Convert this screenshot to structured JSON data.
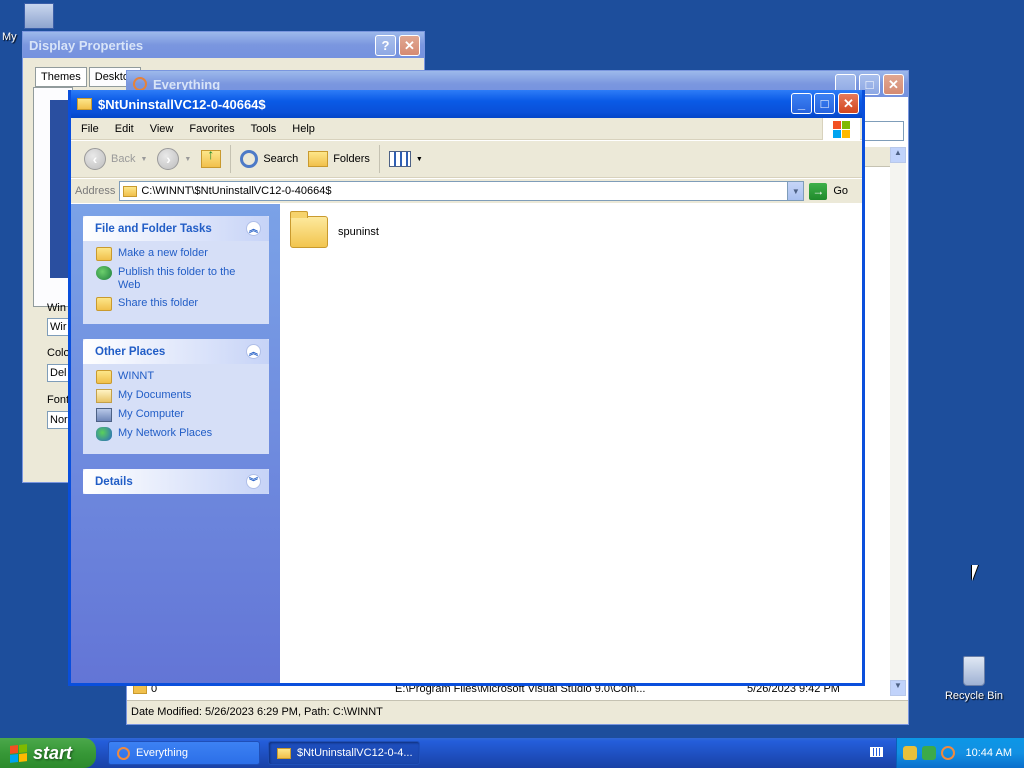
{
  "desktop": {
    "icons": [
      {
        "label": "My",
        "name": "my-computer"
      },
      {
        "label": "Recycle Bin",
        "name": "recycle-bin"
      }
    ]
  },
  "display_properties": {
    "title": "Display Properties",
    "tabs": [
      "Themes",
      "Desktop"
    ],
    "partial_labels": [
      "Win",
      "Colo",
      "Font"
    ],
    "partial_values": [
      "Wir",
      "Del",
      "Nor"
    ]
  },
  "everything_window": {
    "title": "Everything",
    "row": {
      "name": "0",
      "path": "E:\\Program Files\\Microsoft Visual Studio 9.0\\Com...",
      "date": "5/26/2023 9:42 PM"
    },
    "status": "Date Modified: 5/26/2023 6:29 PM, Path: C:\\WINNT"
  },
  "explorer": {
    "title": "$NtUninstallVC12-0-40664$",
    "menu": [
      "File",
      "Edit",
      "View",
      "Favorites",
      "Tools",
      "Help"
    ],
    "toolbar": {
      "back": "Back",
      "search": "Search",
      "folders": "Folders"
    },
    "address": {
      "label": "Address",
      "value": "C:\\WINNT\\$NtUninstallVC12-0-40664$",
      "go": "Go"
    },
    "panels": {
      "file_tasks": {
        "title": "File and Folder Tasks",
        "items": [
          "Make a new folder",
          "Publish this folder to the Web",
          "Share this folder"
        ]
      },
      "other_places": {
        "title": "Other Places",
        "items": [
          "WINNT",
          "My Documents",
          "My Computer",
          "My Network Places"
        ]
      },
      "details": {
        "title": "Details"
      }
    },
    "files": [
      {
        "name": "spuninst",
        "icon": "folder-icon"
      }
    ]
  },
  "taskbar": {
    "start": "start",
    "tasks": [
      {
        "label": "Everything",
        "active": false
      },
      {
        "label": "$NtUninstallVC12-0-4...",
        "active": true
      }
    ],
    "clock": "10:44 AM"
  }
}
